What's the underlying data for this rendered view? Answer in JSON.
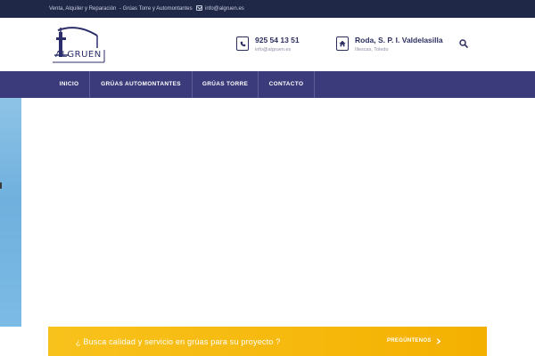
{
  "topbar": {
    "text_services": "Venta, Alquiler y Reparación",
    "text_types": "- Grúas Torre y Automontantes",
    "email": "info@algruen.es"
  },
  "header": {
    "logo_text": "ALGRUEN",
    "phone": {
      "icon": "phone-icon",
      "title": "925 54 13 51",
      "subtitle": "info@algruen.es"
    },
    "address": {
      "icon": "home-icon",
      "title": "Roda, S. P. I. Valdelasilla",
      "subtitle": "Illescas, Toledo"
    },
    "search_icon": "search-icon"
  },
  "nav": {
    "items": [
      {
        "label": "INICIO",
        "active": true
      },
      {
        "label": "GRÚAS AUTOMONTANTES",
        "active": false
      },
      {
        "label": "GRÚAS TORRE",
        "active": false
      },
      {
        "label": "CONTACTO",
        "active": false
      }
    ]
  },
  "cta": {
    "text": "¿ Busca calidad y servicio en grúas para su proyecto ?",
    "button_label": "PREGÚNTENOS",
    "button_icon": "chevron-right-icon"
  },
  "colors": {
    "topbar_bg": "#1f2847",
    "nav_bg": "#3b3a7a",
    "brand_navy": "#2d2f5f",
    "cta_yellow": "#f6b80c"
  }
}
